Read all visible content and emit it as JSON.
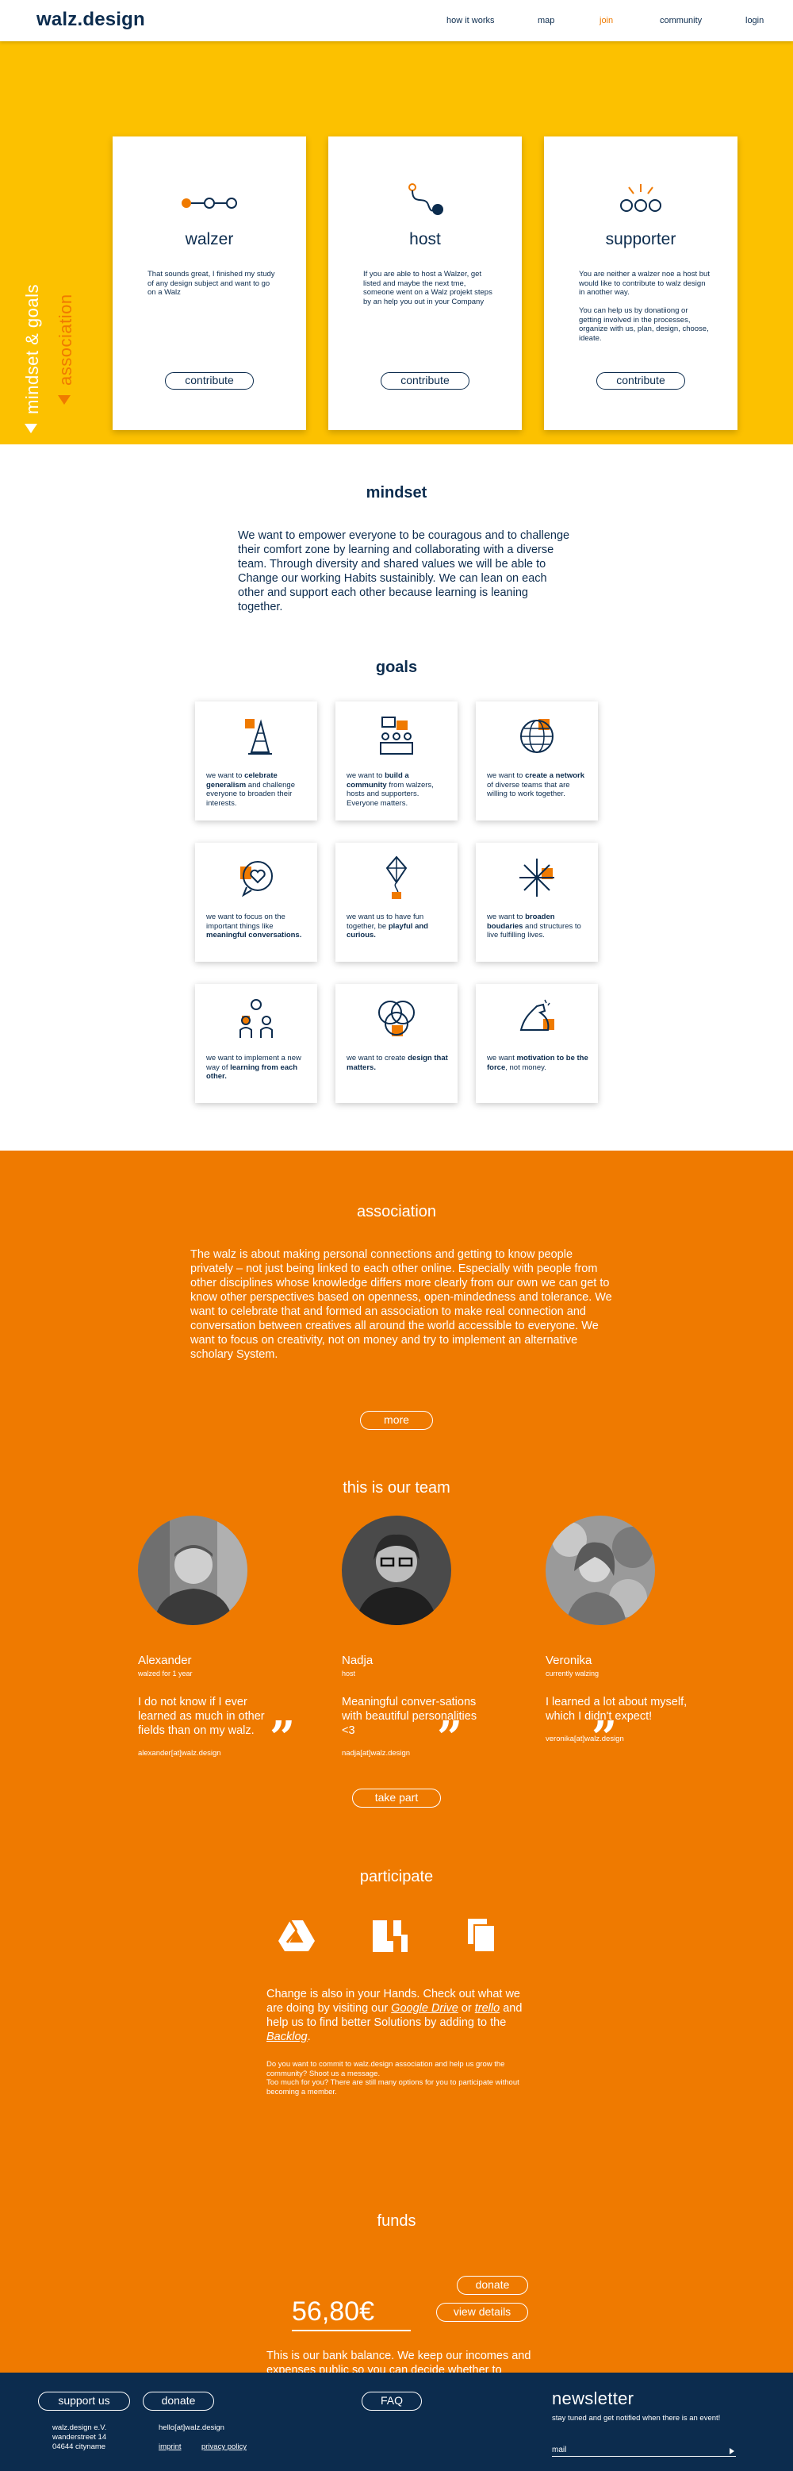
{
  "header": {
    "logo": "walz.design",
    "nav": [
      "how it works",
      "map",
      "join",
      "community",
      "login"
    ],
    "active_index": 2
  },
  "side_labels": {
    "primary": "mindset & goals",
    "secondary": "association"
  },
  "cards": [
    {
      "title": "walzer",
      "text": "That sounds great, I finished my study of any design subject and want to go on a Walz",
      "button": "contribute",
      "icon": "path-dots-icon"
    },
    {
      "title": "host",
      "text": "If you are able to host a Walzer, get listed and maybe the next tme, someone went on a Walz projekt steps by an help you out in your Company",
      "button": "contribute",
      "icon": "winding-path-icon"
    },
    {
      "title": "supporter",
      "text": "You are neither a walzer noe a host but would like to contribute to walz design in another way.\n\nYou can help us by donatiiong or getting involved in the processes, organize with us, plan, design, choose, ideate.",
      "button": "contribute",
      "icon": "circles-rays-icon"
    }
  ],
  "mindset": {
    "title": "mindset",
    "text": "We want to empower everyone to be couragous and to challenge their comfort zone by learning and collaborating with a diverse team. Through diversity and shared values we will be able to Change our working Habits sustainibly. We can lean on each other and support each other because learning is leaning together."
  },
  "goals": {
    "title": "goals",
    "items": [
      {
        "pre": "we want to ",
        "bold": "celebrate generalism",
        "post": " and challenge everyone to broaden their interests.",
        "icon": "party-hat-icon"
      },
      {
        "pre": "we want to ",
        "bold": "build a community",
        "post": " from walzers, hosts and supporters. Everyone matters.",
        "icon": "community-chat-icon"
      },
      {
        "pre": "we want to ",
        "bold": "create a network",
        "post": " of diverse teams that are willing to work together.",
        "icon": "globe-network-icon"
      },
      {
        "pre": "we want to focus on the important things like ",
        "bold": "meaningful conversations.",
        "post": "",
        "icon": "heart-bubble-icon"
      },
      {
        "pre": "we want us to have fun together, be ",
        "bold": "playful and curious.",
        "post": "",
        "icon": "kite-icon"
      },
      {
        "pre": "we want to ",
        "bold": "broaden boudaries",
        "post": " and structures to live fulfilling lives.",
        "icon": "expand-arrows-icon"
      },
      {
        "pre": "we want to implement a new way of ",
        "bold": "learning from each other.",
        "post": "",
        "icon": "learning-people-icon"
      },
      {
        "pre": "we want to create ",
        "bold": "design that matters.",
        "post": "",
        "icon": "venn-design-icon"
      },
      {
        "pre": "we want ",
        "bold": "motivation to be the force",
        "post": ", not money.",
        "icon": "muscle-arm-icon"
      }
    ]
  },
  "association": {
    "title": "association",
    "text": "The walz is about making personal connections and getting to know people privately – not just being linked to each other online. Especially with people from other disciplines whose knowledge differs more clearly from our  own we can get to know other perspectives based on openness, open-mindedness and tolerance.\nWe want to celebrate that and formed an association to make real connection and conversation between creatives all around the world accessible to everyone. We want to focus on creativity, not on money and try to implement an alternative scholary System.",
    "button": "more"
  },
  "team": {
    "title": "this is our team",
    "members": [
      {
        "name": "Alexander",
        "role": "walzed for 1 year",
        "quote": "I do not know if I ever learned as much in other fields than on my walz.",
        "email": "alexander[at]walz.design"
      },
      {
        "name": "Nadja",
        "role": "host",
        "quote": "Meaningful conver-sations with beautiful personalities <3",
        "email": "nadja[at]walz.design"
      },
      {
        "name": "Veronika",
        "role": "currently walzing",
        "quote": "I learned a lot about myself, which I didn't expect!",
        "email": "veronika[at]walz.design"
      }
    ],
    "button": "take part"
  },
  "participate": {
    "title": "participate",
    "tools": [
      "google-drive-icon",
      "trello-icon",
      "backlog-icon"
    ],
    "text_pre": "Change is also in your Hands. Check out what we are doing by visiting our ",
    "link1": "Google Drive",
    "text_mid1": " or ",
    "link2": "trello",
    "text_mid2": " and  help us to find better Solutions by adding to the ",
    "link3": "Backlog",
    "text_end": ".",
    "small": "Do you want to commit to walz.design association and help us grow the community? Shoot us a message.\nToo much for you? There are still many options for you to participate without becoming a member."
  },
  "funds": {
    "title": "funds",
    "amount": "56,80€",
    "donate": "donate",
    "details": "view details",
    "text": "This is our bank balance. We keep our incomes and expenses public so you can decide whether to support us monetarily or  through actions."
  },
  "footer": {
    "support": "support us",
    "donate": "donate",
    "faq": "FAQ",
    "address": [
      "walz.design e.V.",
      "wanderstreet 14",
      "04644 cityname"
    ],
    "email": "hello[at]walz.design",
    "imprint": "imprint",
    "privacy": "privacy policy",
    "newsletter_title": "newsletter",
    "newsletter_sub": "stay tuned and get notified when there is an event!",
    "mail_placeholder": "mail"
  },
  "colors": {
    "navy": "#0c2c4e",
    "yellow": "#fcc100",
    "orange": "#ef7a00",
    "white": "#ffffff"
  }
}
